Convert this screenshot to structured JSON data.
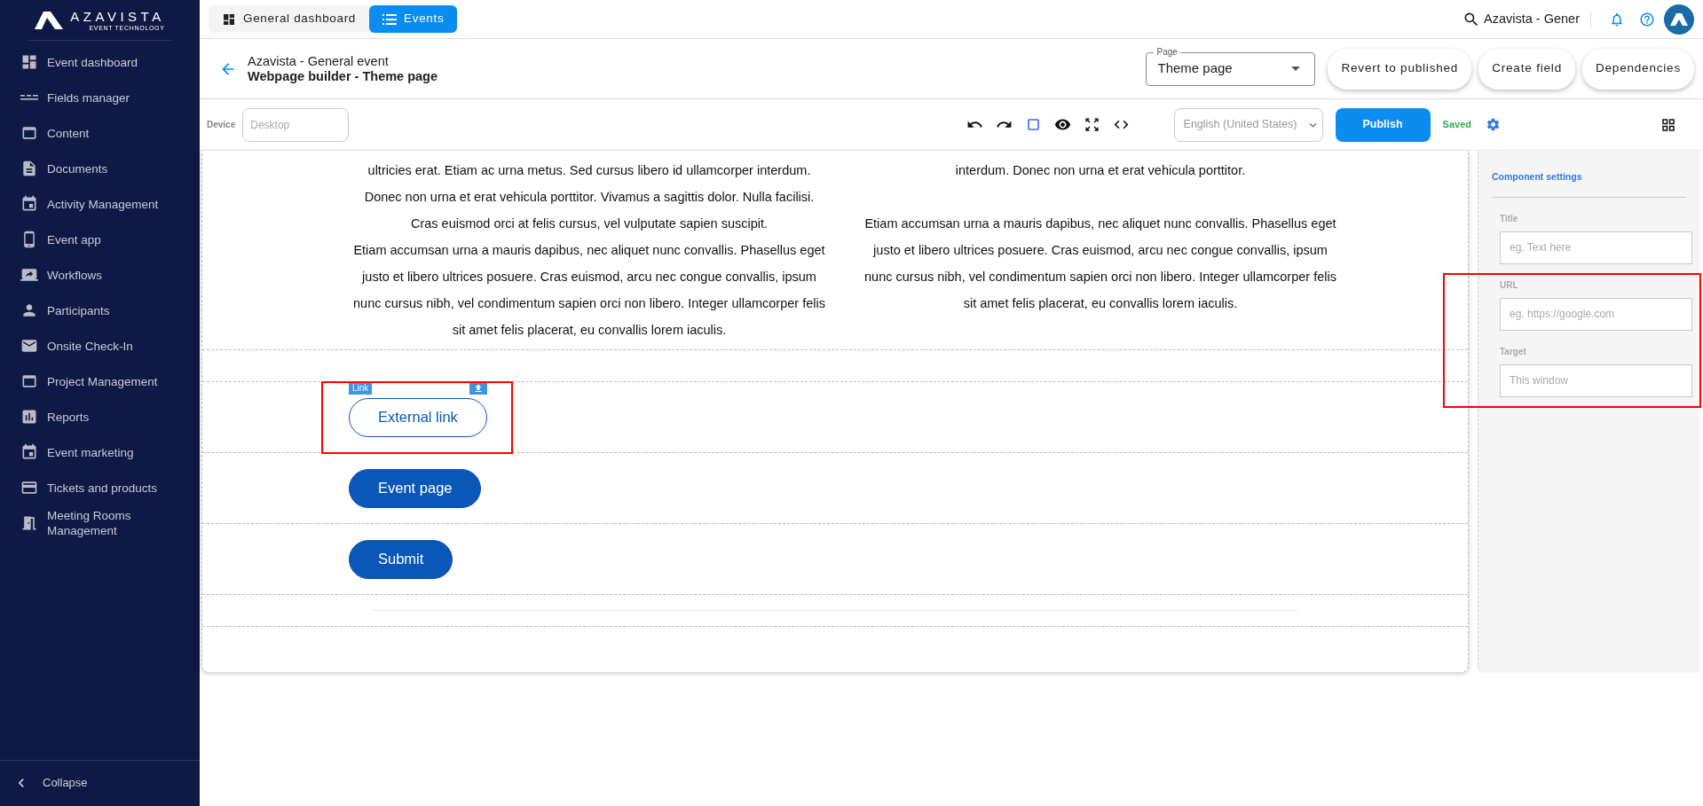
{
  "brand": {
    "name": "AZAVISTA",
    "tagline": "EVENT TECHNOLOGY"
  },
  "sidebar": {
    "items": [
      {
        "label": "Event dashboard"
      },
      {
        "label": "Fields manager"
      },
      {
        "label": "Content"
      },
      {
        "label": "Documents"
      },
      {
        "label": "Activity Management"
      },
      {
        "label": "Event app"
      },
      {
        "label": "Workflows"
      },
      {
        "label": "Participants"
      },
      {
        "label": "Onsite Check-In"
      },
      {
        "label": "Project Management"
      },
      {
        "label": "Reports"
      },
      {
        "label": "Event marketing"
      },
      {
        "label": "Tickets and products"
      },
      {
        "label": "Meeting Rooms Management"
      }
    ],
    "collapse": "Collapse"
  },
  "top_tabs": [
    {
      "label": "General dashboard",
      "selected": false
    },
    {
      "label": "Events",
      "selected": true
    }
  ],
  "search": {
    "value": "Azavista - Gener"
  },
  "header": {
    "event": "Azavista - General event",
    "title": "Webpage builder - Theme page",
    "page_select": {
      "label": "Page",
      "value": "Theme page"
    },
    "buttons": [
      "Revert to published",
      "Create field",
      "Dependencies"
    ]
  },
  "toolbar": {
    "device_label": "Device",
    "device_placeholder": "Desktop",
    "language": "English (United States)",
    "publish": "Publish",
    "status": "Saved"
  },
  "canvas": {
    "columns": [
      [
        [
          "ultricies erat. Etiam ac urna metus. Sed cursus libero id ullamcorper interdum.",
          "Donec non urna et erat vehicula porttitor. Vivamus a sagittis dolor. Nulla facilisi.",
          "Cras euismod orci at felis cursus, vel vulputate sapien suscipit."
        ],
        [
          "Etiam accumsan urna a mauris dapibus, nec aliquet nunc convallis. Phasellus eget",
          "justo et libero ultrices posuere. Cras euismod, arcu nec congue convallis, ipsum",
          "nunc cursus nibh, vel condimentum sapien orci non libero. Integer ullamcorper felis",
          "sit amet felis placerat, eu convallis lorem iaculis."
        ]
      ],
      [
        [
          "interdum. Donec non urna et erat vehicula porttitor."
        ],
        [
          "Etiam accumsan urna a mauris dapibus, nec aliquet nunc convallis. Phasellus eget",
          "justo et libero ultrices posuere. Cras euismod, arcu nec congue convallis, ipsum",
          "nunc cursus nibh, vel condimentum sapien orci non libero. Integer ullamcorper felis",
          "sit amet felis placerat, eu convallis lorem iaculis."
        ]
      ]
    ],
    "blocks": [
      {
        "kind": "empty"
      },
      {
        "kind": "button",
        "label": "External link",
        "tag": "Link",
        "selected": true
      },
      {
        "kind": "button",
        "label": "Event page",
        "selected": false
      },
      {
        "kind": "button",
        "label": "Submit",
        "selected": false
      },
      {
        "kind": "divider"
      },
      {
        "kind": "empty"
      }
    ]
  },
  "settings": {
    "title": "Component settings",
    "fields": [
      {
        "label": "Title",
        "placeholder": "eg. Text here"
      },
      {
        "label": "URL",
        "placeholder": "eg. https://google.com"
      },
      {
        "label": "Target",
        "placeholder": "This window"
      }
    ]
  }
}
